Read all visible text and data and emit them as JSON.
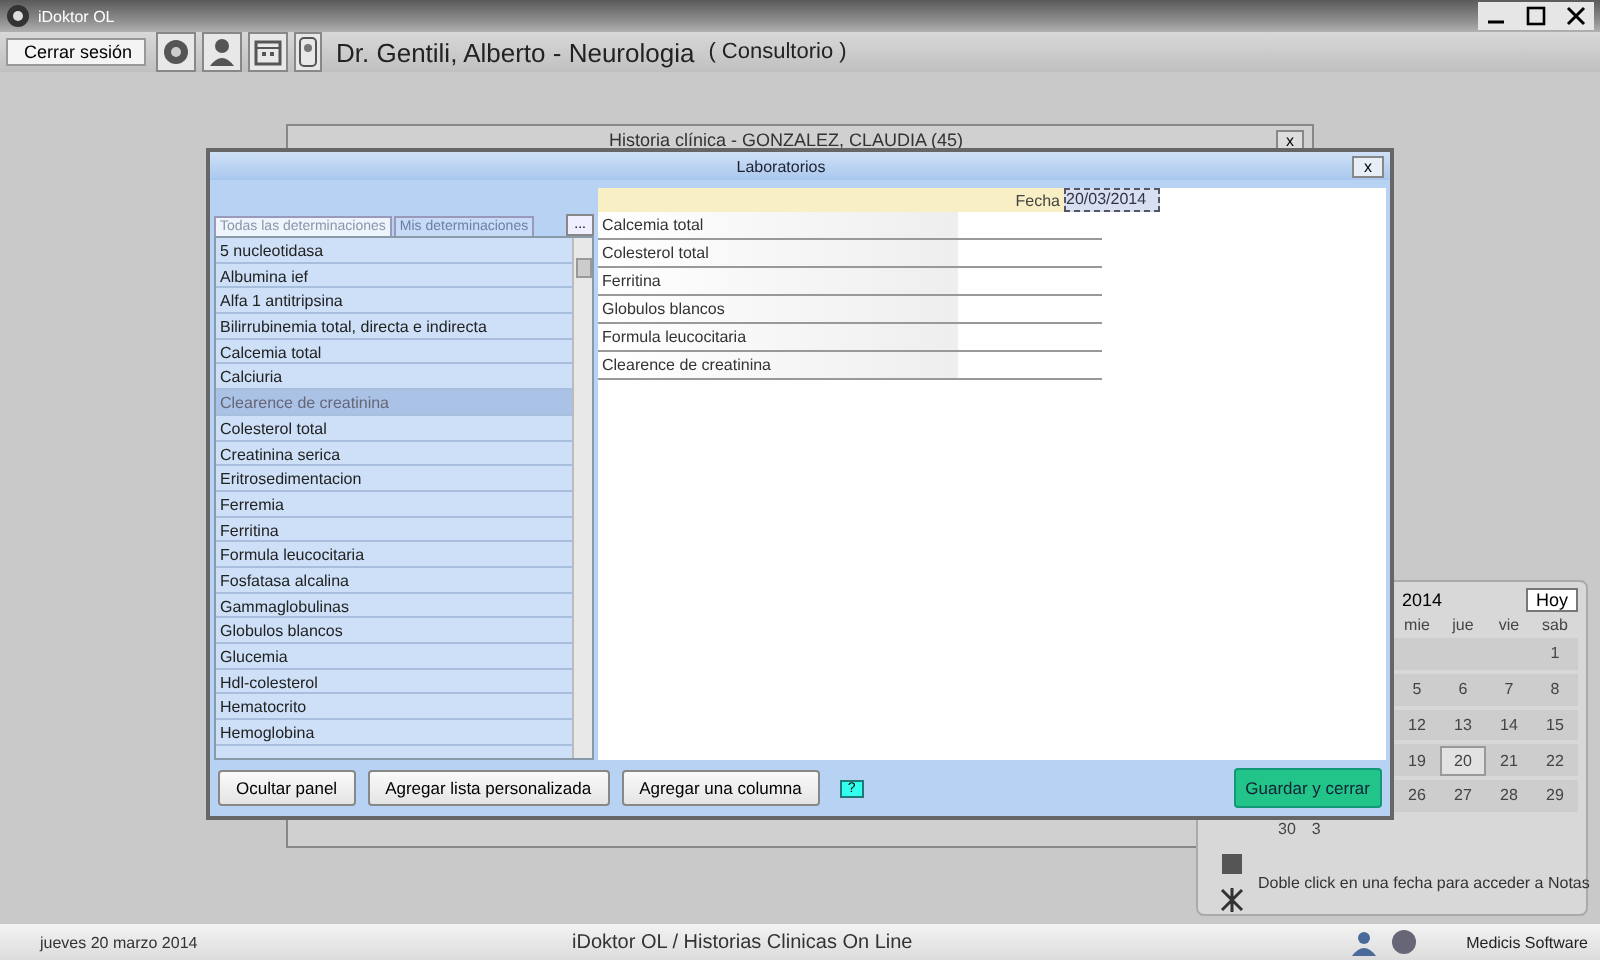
{
  "app_title": "iDoktor OL",
  "toolbar": {
    "logout_button": "Cerrar sesión",
    "doctor": "Dr. Gentili, Alberto - Neurologia",
    "context": "( Consultorio )"
  },
  "background_window": {
    "title": "Historia clínica - GONZALEZ, CLAUDIA (45)",
    "close": "x"
  },
  "calendar": {
    "year": "2014",
    "today_button": "Hoy",
    "weekdays": [
      "mie",
      "jue",
      "vie",
      "sab"
    ],
    "weeks": [
      [
        {
          "label": "1",
          "selected": false
        }
      ],
      [
        {
          "label": "5",
          "selected": false
        },
        {
          "label": "6",
          "selected": false
        },
        {
          "label": "7",
          "selected": false
        },
        {
          "label": "8",
          "selected": false
        }
      ],
      [
        {
          "label": "12",
          "selected": false
        },
        {
          "label": "13",
          "selected": false
        },
        {
          "label": "14",
          "selected": false
        },
        {
          "label": "15",
          "selected": false
        }
      ],
      [
        {
          "label": "19",
          "selected": false
        },
        {
          "label": "20",
          "selected": true
        },
        {
          "label": "21",
          "selected": false
        },
        {
          "label": "22",
          "selected": false
        }
      ],
      [
        {
          "label": "26",
          "selected": false
        },
        {
          "label": "27",
          "selected": false
        },
        {
          "label": "28",
          "selected": false
        },
        {
          "label": "29",
          "selected": false
        }
      ]
    ],
    "partial_week": [
      "30",
      "3"
    ],
    "hint": "Doble click en una fecha para acceder a Notas"
  },
  "modal": {
    "title": "Laboratorios",
    "close": "x",
    "tabs": [
      {
        "label": "Todas las determinaciones",
        "selected": true
      },
      {
        "label": "Mis determinaciones",
        "selected": false
      }
    ],
    "more_button": "...",
    "list": [
      {
        "label": "5 nucleotidasa",
        "selected": false
      },
      {
        "label": "Albumina ief",
        "selected": false
      },
      {
        "label": "Alfa 1 antitripsina",
        "selected": false
      },
      {
        "label": "Bilirrubinemia total, directa e indirecta",
        "selected": false
      },
      {
        "label": "Calcemia total",
        "selected": false
      },
      {
        "label": "Calciuria",
        "selected": false
      },
      {
        "label": "Clearence de creatinina",
        "selected": true
      },
      {
        "label": "Colesterol total",
        "selected": false
      },
      {
        "label": "Creatinina serica",
        "selected": false
      },
      {
        "label": "Eritrosedimentacion",
        "selected": false
      },
      {
        "label": "Ferremia",
        "selected": false
      },
      {
        "label": "Ferritina",
        "selected": false
      },
      {
        "label": "Formula leucocitaria",
        "selected": false
      },
      {
        "label": "Fosfatasa alcalina",
        "selected": false
      },
      {
        "label": "Gammaglobulinas",
        "selected": false
      },
      {
        "label": "Globulos blancos",
        "selected": false
      },
      {
        "label": "Glucemia",
        "selected": false
      },
      {
        "label": "Hdl-colesterol",
        "selected": false
      },
      {
        "label": "Hematocrito",
        "selected": false
      },
      {
        "label": "Hemoglobina",
        "selected": false
      }
    ],
    "table": {
      "date_label": "Fecha",
      "date": "20/03/2014",
      "rows": [
        "Calcemia total",
        "Colesterol total",
        "Ferritina",
        "Globulos blancos",
        "Formula leucocitaria",
        "Clearence de creatinina"
      ]
    },
    "buttons": [
      "Ocultar panel",
      "Agregar lista personalizada",
      "Agregar una columna"
    ],
    "help_button": "?",
    "save_button": "Guardar y cerrar"
  },
  "status_bar": {
    "date": "jueves 20 marzo 2014",
    "center": "iDoktor OL  /  Historias Clinicas On Line",
    "vendor": "Medicis Software"
  }
}
